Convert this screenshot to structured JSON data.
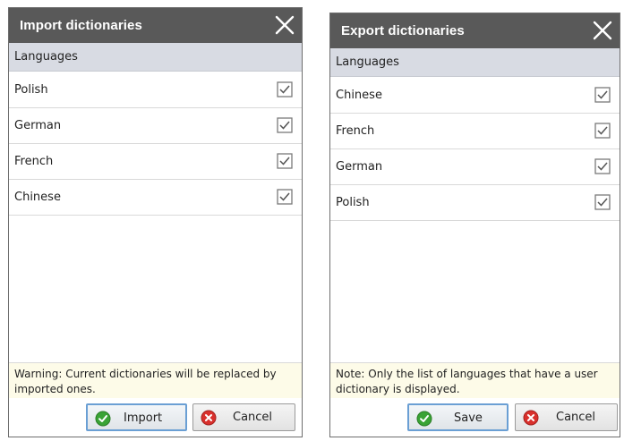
{
  "import_dialog": {
    "title": "Import dictionaries",
    "column_header": "Languages",
    "rows": [
      {
        "label": "Polish",
        "checked": true
      },
      {
        "label": "German",
        "checked": true
      },
      {
        "label": "French",
        "checked": true
      },
      {
        "label": "Chinese",
        "checked": true
      }
    ],
    "notice": "Warning: Current dictionaries will be replaced by imported ones.",
    "ok_label": "Import",
    "cancel_label": "Cancel"
  },
  "export_dialog": {
    "title": "Export dictionaries",
    "column_header": "Languages",
    "rows": [
      {
        "label": "Chinese",
        "checked": true
      },
      {
        "label": "French",
        "checked": true
      },
      {
        "label": "German",
        "checked": true
      },
      {
        "label": "Polish",
        "checked": true
      }
    ],
    "notice": "Note: Only the list of languages that have a user dictionary is displayed.",
    "ok_label": "Save",
    "cancel_label": "Cancel"
  },
  "icons": {
    "close": "close-icon",
    "checkbox": "checkbox-checked-icon",
    "ok": "green-check-circle-icon",
    "cancel": "red-x-circle-icon"
  },
  "colors": {
    "titlebar": "#595959",
    "header": "#d8dbe3",
    "notice_bg": "#fdfbe8",
    "primary_border": "#6a9fd4",
    "ok_green": "#3aa335",
    "cancel_red": "#d9302c"
  }
}
